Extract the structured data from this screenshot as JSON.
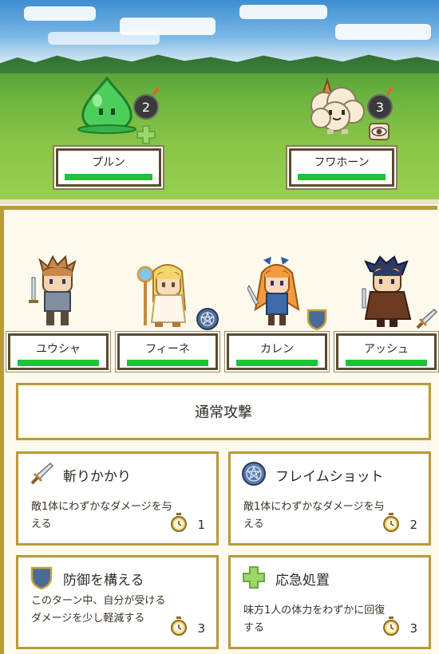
{
  "enemies": [
    {
      "name": "プルン",
      "count": "2",
      "status_icon": "heal-cross-icon",
      "hp": 1.0
    },
    {
      "name": "フワホーン",
      "count": "3",
      "status_icon": "eye-icon",
      "hp": 1.0
    }
  ],
  "party": [
    {
      "name": "ユウシャ",
      "hp": 1.0,
      "status_icon": ""
    },
    {
      "name": "フィーネ",
      "hp": 1.0,
      "status_icon": "pentagram-icon"
    },
    {
      "name": "カレン",
      "hp": 1.0,
      "status_icon": "shield-icon"
    },
    {
      "name": "アッシュ",
      "hp": 1.0,
      "status_icon": "sword-icon"
    }
  ],
  "actions": {
    "normal_attack": "通常攻撃",
    "skills": [
      {
        "title": "斬りかかり",
        "desc": "敵1体にわずかなダメージを与える",
        "cost": "1",
        "icon": "sword-icon"
      },
      {
        "title": "フレイムショット",
        "desc": "敵1体にわずかなダメージを与える",
        "cost": "2",
        "icon": "pentagram-icon"
      },
      {
        "title": "防御を構える",
        "desc": "このターン中、自分が受けるダメージを少し軽減する",
        "cost": "3",
        "icon": "shield-icon"
      },
      {
        "title": "応急処置",
        "desc": "味方1人の体力をわずかに回復する",
        "cost": "3",
        "icon": "heal-cross-icon"
      }
    ]
  },
  "colors": {
    "hp": "#20c03a",
    "frame": "#b79b3c",
    "panel_bg": "#fdf9ec"
  }
}
